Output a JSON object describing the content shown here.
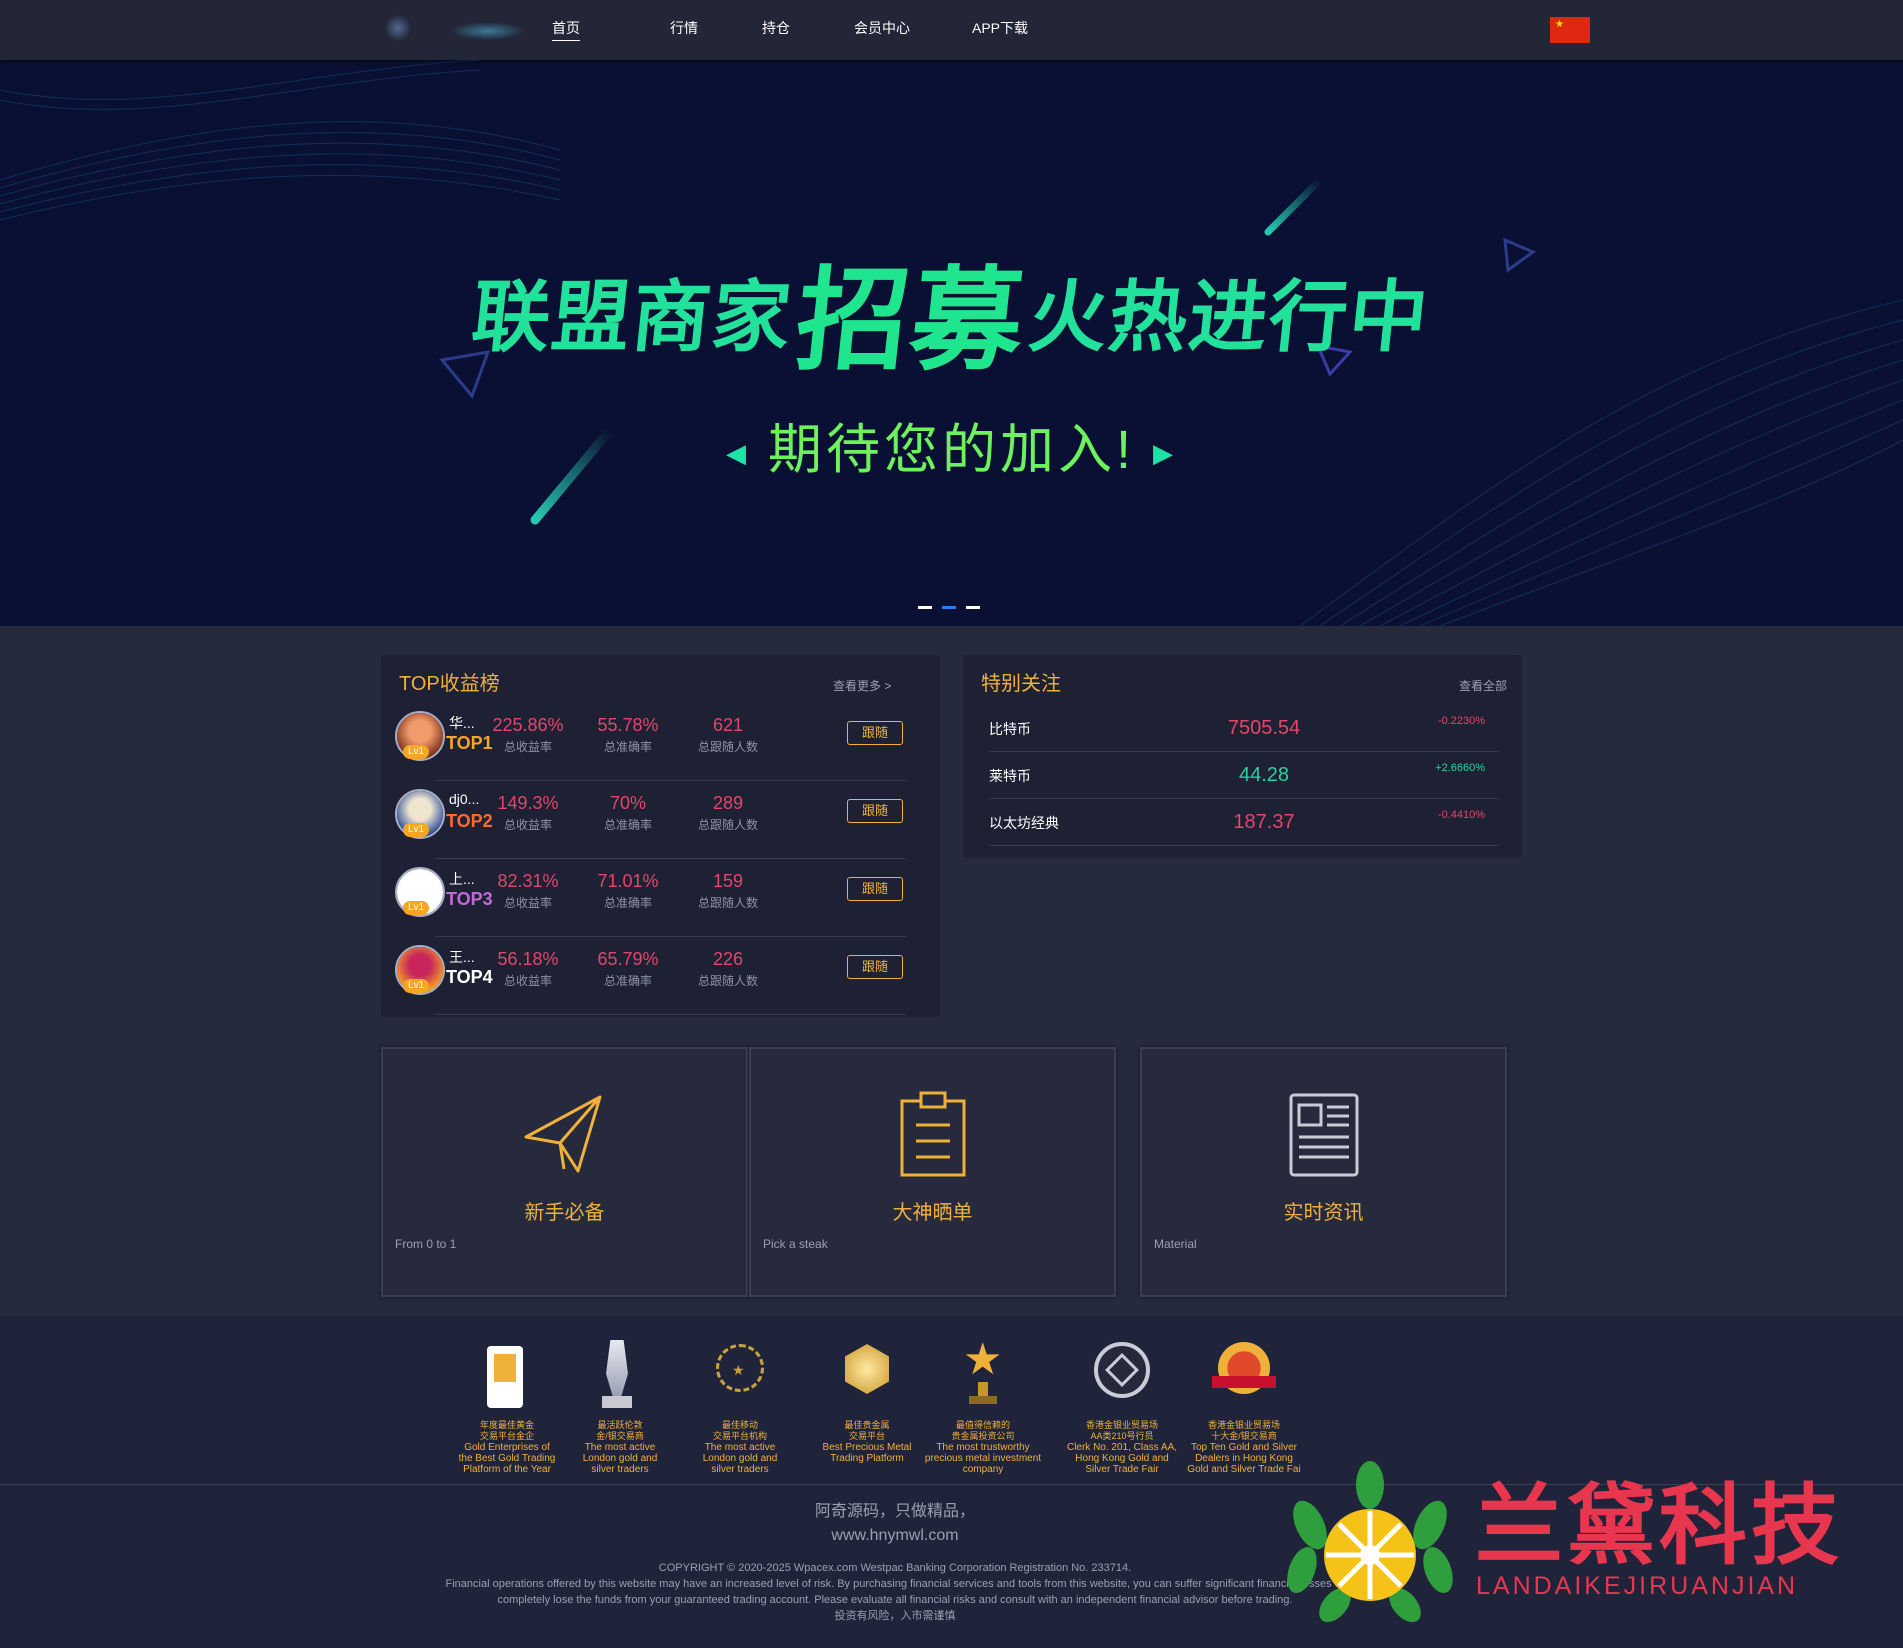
{
  "nav": {
    "links": [
      "首页",
      "行情",
      "持仓",
      "会员中心",
      "APP下载"
    ],
    "active_index": 0
  },
  "banner": {
    "headline_a": "联盟商家",
    "headline_b": "招募",
    "headline_c": "火热进行中",
    "subline": "期待您的加入!",
    "slides": 3,
    "active_slide": 1,
    "accent": "#22e19a"
  },
  "top_ranking": {
    "title": "TOP收益榜",
    "more": "查看更多 >",
    "rows": [
      {
        "name": "华...",
        "rank": "TOP1",
        "level": "Lv1",
        "total_return": "225.86%",
        "accuracy": "55.78%",
        "followers": "621",
        "return_label": "总收益率",
        "accuracy_label": "总准确率",
        "followers_label": "总跟随人数",
        "follow_label": "跟随",
        "rank_color": "#f5a623"
      },
      {
        "name": "dj0...",
        "rank": "TOP2",
        "level": "Lv1",
        "total_return": "149.3%",
        "accuracy": "70%",
        "followers": "289",
        "return_label": "总收益率",
        "accuracy_label": "总准确率",
        "followers_label": "总跟随人数",
        "follow_label": "跟随",
        "rank_color": "#ff6a2b"
      },
      {
        "name": "上...",
        "rank": "TOP3",
        "level": "Lv1",
        "total_return": "82.31%",
        "accuracy": "71.01%",
        "followers": "159",
        "return_label": "总收益率",
        "accuracy_label": "总准确率",
        "followers_label": "总跟随人数",
        "follow_label": "跟随",
        "rank_color": "#c06ad8"
      },
      {
        "name": "王...",
        "rank": "TOP4",
        "level": "Lv1",
        "total_return": "56.18%",
        "accuracy": "65.79%",
        "followers": "226",
        "return_label": "总收益率",
        "accuracy_label": "总准确率",
        "followers_label": "总跟随人数",
        "follow_label": "跟随",
        "rank_color": "#ffffff"
      }
    ]
  },
  "watchlist": {
    "title": "特别关注",
    "more": "查看全部",
    "rows": [
      {
        "name": "比特币",
        "price": "7505.54",
        "change": "-0.2230%",
        "dir": "down"
      },
      {
        "name": "莱特币",
        "price": "44.28",
        "change": "+2.6660%",
        "dir": "up"
      },
      {
        "name": "以太坊经典",
        "price": "187.37",
        "change": "-0.4410%",
        "dir": "down"
      }
    ]
  },
  "features": [
    {
      "title": "新手必备",
      "sub": "From 0 to 1",
      "icon": "paper-plane-icon"
    },
    {
      "title": "大神晒单",
      "sub": "Pick a steak",
      "icon": "clipboard-icon"
    },
    {
      "title": "实时资讯",
      "sub": "Material",
      "icon": "newspaper-icon"
    }
  ],
  "awards": [
    {
      "cn": "年度最佳黄金\n交易平台金企",
      "en": "Gold Enterprises of\nthe Best Gold Trading\nPlatform of the Year",
      "icon": "gold-plaque-icon"
    },
    {
      "cn": "最活跃伦敦\n金/银交易商",
      "en": "The most active\nLondon gold and\nsilver traders",
      "icon": "crystal-trophy-icon"
    },
    {
      "cn": "最佳移动\n交易平台机构",
      "en": "The most active\nLondon gold and\nsilver traders",
      "icon": "laurel-badge-icon"
    },
    {
      "cn": "最佳贵金属\n交易平台",
      "en": "Best Precious Metal\nTrading Platform",
      "icon": "gold-medal-icon"
    },
    {
      "cn": "最值得信赖的\n贵金属投资公司",
      "en": "The most trustworthy\nprecious metal investment\ncompany",
      "icon": "star-trophy-icon"
    },
    {
      "cn": "香港金银业贸易场\nAA类210号行员",
      "en": "Clerk No. 201, Class AA,\nHong Kong Gold and\nSilver Trade Fair",
      "icon": "seal-icon"
    },
    {
      "cn": "香港金银业贸易场\n十大金/银交易商",
      "en": "Top Ten Gold and Silver\nDealers in Hong Kong\nGold and Silver Trade Fai",
      "icon": "red-ribbon-seal-icon"
    }
  ],
  "footer": {
    "slogan_1": "阿奇源码，只做精品，",
    "slogan_2": "www.hnymwl.com",
    "copyright": "COPYRIGHT © 2020-2025 Wpacex.com Westpac Banking Corporation Registration No. 233714.",
    "disclaimer_1": "Financial operations offered by this website may have an increased level of risk. By purchasing financial services and tools from this website, you can suffer significant financial losses or",
    "disclaimer_2": "completely lose the funds from your guaranteed trading account. Please evaluate all financial risks and consult with an independent financial advisor before trading.",
    "warning": "投资有风险，入市需谨慎"
  },
  "watermark": {
    "text": "兰黛科技",
    "sub": "LANDAIKEJIRUANJIAN"
  }
}
